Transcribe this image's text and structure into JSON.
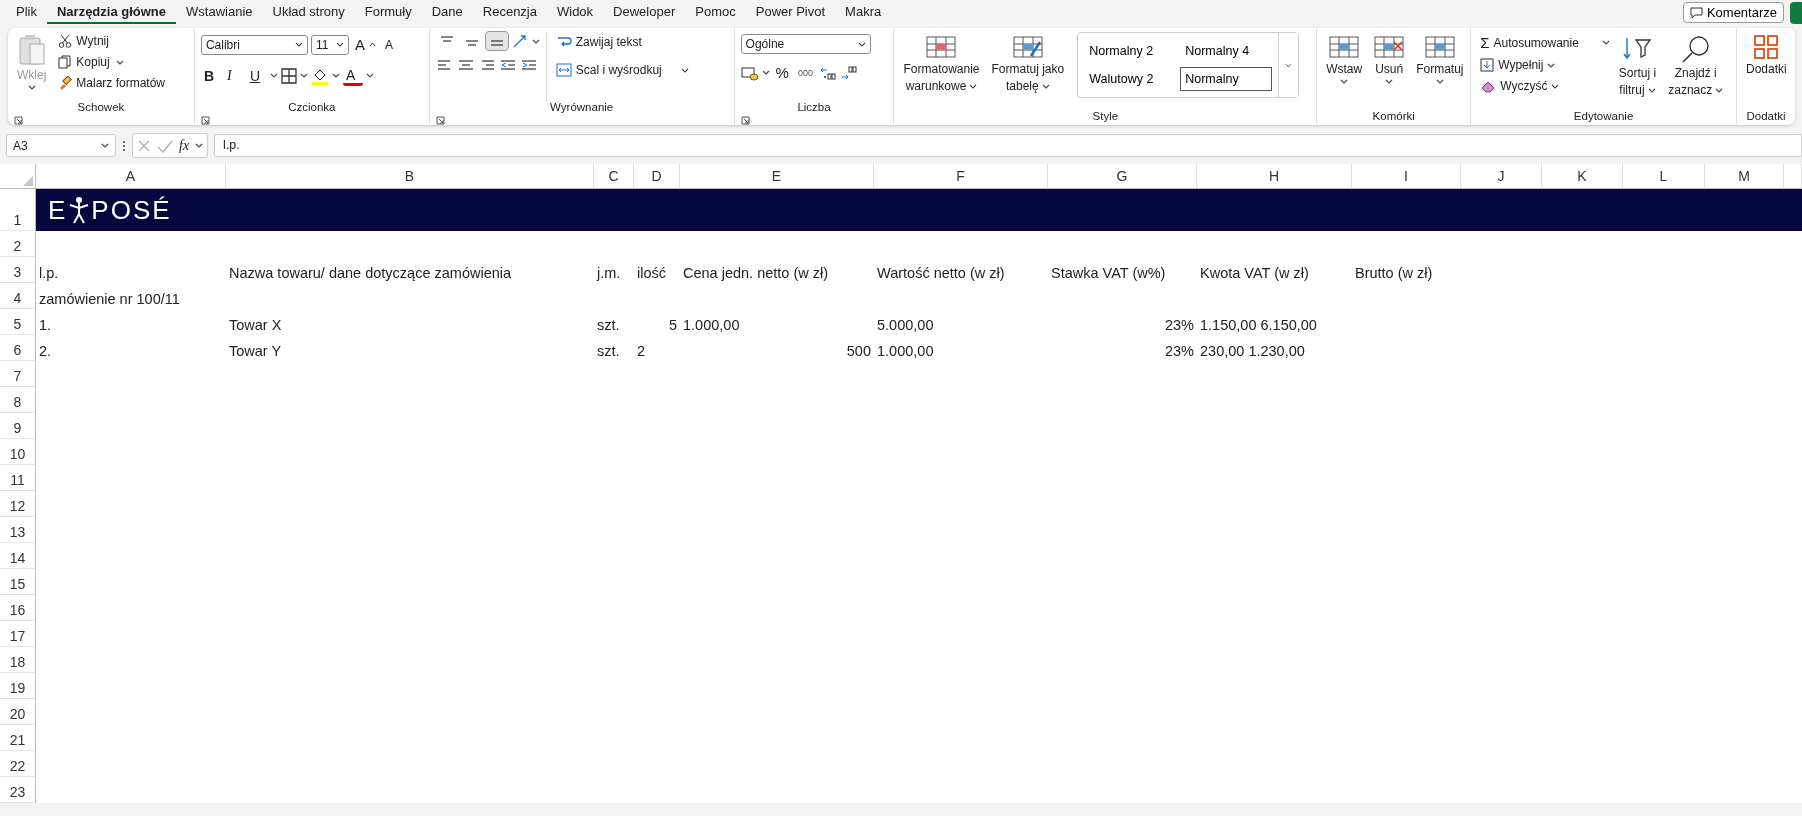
{
  "menu_tabs": [
    {
      "label": "Plik",
      "selected": false
    },
    {
      "label": "Narzędzia główne",
      "selected": true
    },
    {
      "label": "Wstawianie",
      "selected": false
    },
    {
      "label": "Układ strony",
      "selected": false
    },
    {
      "label": "Formuły",
      "selected": false
    },
    {
      "label": "Dane",
      "selected": false
    },
    {
      "label": "Recenzja",
      "selected": false
    },
    {
      "label": "Widok",
      "selected": false
    },
    {
      "label": "Deweloper",
      "selected": false
    },
    {
      "label": "Pomoc",
      "selected": false
    },
    {
      "label": "Power Pivot",
      "selected": false
    },
    {
      "label": "Makra",
      "selected": false
    }
  ],
  "comments_button": "Komentarze",
  "ribbon": {
    "clipboard": {
      "label": "Schowek",
      "paste": {
        "label": "Wklej",
        "disabled": true
      },
      "cut": "Wytnij",
      "copy": "Kopiuj",
      "format_painter": "Malarz formatów"
    },
    "font": {
      "label": "Czcionka",
      "font_name": "Calibri",
      "font_size": "11",
      "grow_glyph": "A",
      "shrink_glyph": "A",
      "bold_glyph": "B",
      "italic_glyph": "I",
      "underline_glyph": "U",
      "font_color_glyph": "A"
    },
    "alignment": {
      "label": "Wyrównanie",
      "vertical_align": [
        {
          "selected": false
        },
        {
          "selected": false
        },
        {
          "selected": true
        }
      ],
      "wrap_text": "Zawijaj tekst",
      "merge_center": "Scal i wyśrodkuj"
    },
    "number": {
      "label": "Liczba",
      "format": "Ogólne",
      "percent_glyph": "%",
      "thousands_glyph": "000"
    },
    "styles": {
      "label": "Style",
      "conditional_formatting": [
        "Formatowanie",
        "warunkowe"
      ],
      "format_as_table": [
        "Formatuj jako",
        "tabelę"
      ],
      "gallery": [
        {
          "label": "Normalny 2",
          "selected": false
        },
        {
          "label": "Normalny 4",
          "selected": false
        },
        {
          "label": "Walutowy 2",
          "selected": false
        },
        {
          "label": "Normalny",
          "selected": true
        }
      ]
    },
    "cells": {
      "label": "Komórki",
      "insert": "Wstaw",
      "delete": "Usuń",
      "format": "Formatuj"
    },
    "editing": {
      "label": "Edytowanie",
      "autosum_glyph": "Σ",
      "autosum": "Autosumowanie",
      "fill": "Wypełnij",
      "clear": "Wyczyść",
      "sort_filter": [
        "Sortuj i",
        "filtruj"
      ],
      "find_select": [
        "Znajdź i",
        "zaznacz"
      ]
    },
    "addins": {
      "label": "Dodatki",
      "button": "Dodatki"
    }
  },
  "formula_bar": {
    "name_box": "A3",
    "function_glyph": "fx",
    "formula": "l.p."
  },
  "sheet": {
    "banner": {
      "logo_left": "E",
      "logo_right": "POSÉ"
    },
    "columns": [
      "A",
      "B",
      "C",
      "D",
      "E",
      "F",
      "G",
      "H",
      "I",
      "J",
      "K",
      "L",
      "M"
    ],
    "rows": [
      {
        "number": "1"
      },
      {
        "number": "2"
      },
      {
        "number": "3",
        "cells": {
          "A": {
            "text": "l.p.",
            "kind": "text"
          },
          "B": {
            "text": "Nazwa towaru/ dane dotyczące zamówienia",
            "kind": "text"
          },
          "C": {
            "text": "j.m.",
            "kind": "text"
          },
          "D": {
            "text": "ilość",
            "kind": "text"
          },
          "E": {
            "text": "Cena jedn. netto (w zł)",
            "kind": "text"
          },
          "F": {
            "text": "Wartość netto (w zł)",
            "kind": "text"
          },
          "G": {
            "text": "Stawka VAT (w%)",
            "kind": "text"
          },
          "H": {
            "text": "Kwota VAT (w zł)",
            "kind": "text"
          },
          "I": {
            "text": "Brutto (w zł)",
            "kind": "text"
          }
        }
      },
      {
        "number": "4",
        "cells": {
          "A": {
            "text": "zamówienie nr 100/11",
            "kind": "text"
          }
        }
      },
      {
        "number": "5",
        "cells": {
          "A": {
            "text": "1.",
            "kind": "text"
          },
          "B": {
            "text": "Towar X",
            "kind": "text"
          },
          "C": {
            "text": "szt.",
            "kind": "text"
          },
          "D": {
            "text": "5",
            "kind": "number"
          },
          "E": {
            "text": "1.000,00",
            "kind": "text"
          },
          "F": {
            "text": "5.000,00",
            "kind": "text"
          },
          "G": {
            "text": "23%",
            "kind": "number"
          },
          "H": {
            "text": "1.150,00 6.150,00",
            "kind": "text"
          }
        }
      },
      {
        "number": "6",
        "cells": {
          "A": {
            "text": "2.",
            "kind": "text"
          },
          "B": {
            "text": "Towar Y",
            "kind": "text"
          },
          "C": {
            "text": "szt.",
            "kind": "text"
          },
          "D": {
            "text": "2",
            "kind": "text"
          },
          "E": {
            "text": "500",
            "kind": "number"
          },
          "F": {
            "text": "1.000,00",
            "kind": "text"
          },
          "G": {
            "text": "23%",
            "kind": "number"
          },
          "H": {
            "text": "230,00 1.230,00",
            "kind": "text"
          }
        }
      },
      {
        "number": "7"
      },
      {
        "number": "8"
      },
      {
        "number": "9"
      },
      {
        "number": "10"
      },
      {
        "number": "11"
      },
      {
        "number": "12"
      },
      {
        "number": "13"
      },
      {
        "number": "14"
      },
      {
        "number": "15"
      },
      {
        "number": "16"
      },
      {
        "number": "17"
      },
      {
        "number": "18"
      },
      {
        "number": "19"
      },
      {
        "number": "20"
      },
      {
        "number": "21"
      },
      {
        "number": "22"
      },
      {
        "number": "23"
      }
    ]
  }
}
